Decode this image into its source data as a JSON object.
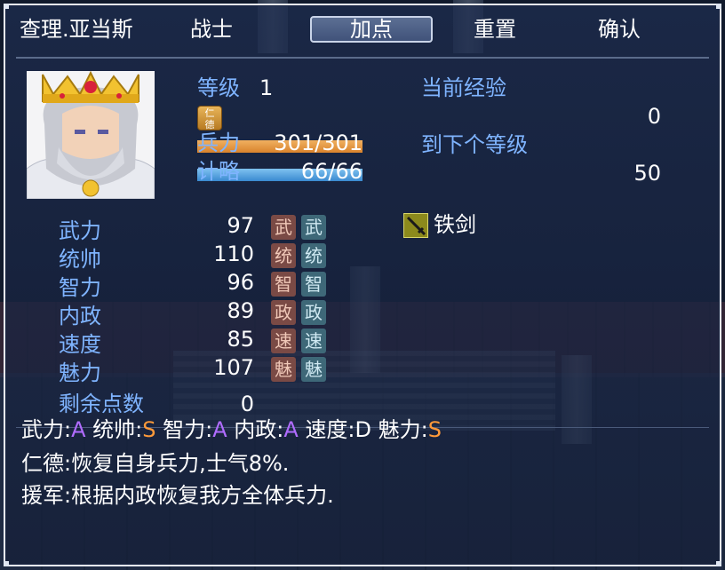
{
  "colors": {
    "exp_bar": "#e08a34",
    "mp_bar": "#3a8ad0",
    "grade_a": "#b06cff",
    "grade_s": "#ff9a3a",
    "label_blue": "#7fb4ff"
  },
  "menu": {
    "name": "查理.亚当斯",
    "class": "战士",
    "add_points": "加点",
    "reset": "重置",
    "confirm": "确认"
  },
  "profile": {
    "level_label": "等级",
    "level": "1",
    "trait_badge": "仁德",
    "hp_label": "兵力",
    "hp_value": "301/301",
    "hp_fill": 1.0,
    "mp_label": "计略",
    "mp_value": "66/66",
    "mp_fill": 1.0,
    "exp_label": "当前经验",
    "exp_value": "0",
    "next_label": "到下个等级",
    "next_value": "50"
  },
  "stats": [
    {
      "name": "武力",
      "value": "97",
      "tag": "武"
    },
    {
      "name": "统帅",
      "value": "110",
      "tag": "统"
    },
    {
      "name": "智力",
      "value": "96",
      "tag": "智"
    },
    {
      "name": "内政",
      "value": "89",
      "tag": "政"
    },
    {
      "name": "速度",
      "value": "85",
      "tag": "速"
    },
    {
      "name": "魅力",
      "value": "107",
      "tag": "魅"
    }
  ],
  "remaining": {
    "label": "剩余点数",
    "value": "0"
  },
  "equipment": {
    "weapon": "铁剑",
    "icon": "sword-icon"
  },
  "grades": [
    {
      "name": "武力:",
      "grade": "A"
    },
    {
      "name": "统帅:",
      "grade": "S"
    },
    {
      "name": "智力:",
      "grade": "A"
    },
    {
      "name": "内政:",
      "grade": "A"
    },
    {
      "name": "速度:",
      "grade": "D"
    },
    {
      "name": "魅力:",
      "grade": "S"
    }
  ],
  "skills": [
    "仁德:恢复自身兵力,士气8%.",
    "援军:根据内政恢复我方全体兵力."
  ]
}
